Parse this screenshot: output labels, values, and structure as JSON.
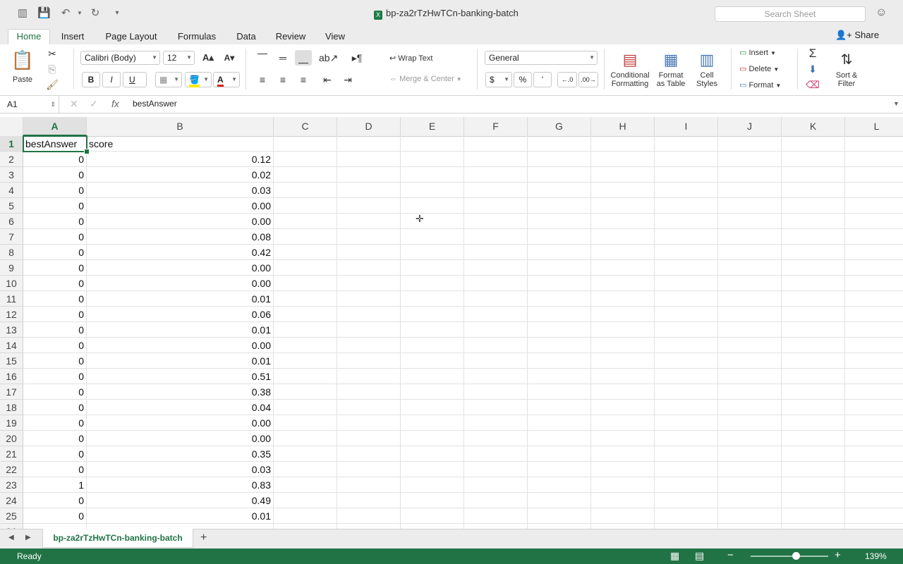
{
  "window": {
    "title": "bp-za2rTzHwTCn-banking-batch",
    "search_placeholder": "Search Sheet"
  },
  "tabs": [
    "Home",
    "Insert",
    "Page Layout",
    "Formulas",
    "Data",
    "Review",
    "View"
  ],
  "active_tab": "Home",
  "share_label": "Share",
  "ribbon": {
    "paste": "Paste",
    "font_name": "Calibri (Body)",
    "font_size": "12",
    "bold": "B",
    "italic": "I",
    "underline": "U",
    "wrap_text": "Wrap Text",
    "merge_center": "Merge & Center",
    "number_format": "General",
    "currency": "$",
    "percent": "%",
    "comma": "’",
    "conditional_formatting": [
      "Conditional",
      "Formatting"
    ],
    "format_as_table": [
      "Format",
      "as Table"
    ],
    "cell_styles": [
      "Cell",
      "Styles"
    ],
    "insert": "Insert",
    "delete": "Delete",
    "format": "Format",
    "sort_filter": [
      "Sort &",
      "Filter"
    ]
  },
  "formula_bar": {
    "name_box": "A1",
    "content": "bestAnswer"
  },
  "sheet": {
    "columns": [
      "A",
      "B",
      "C",
      "D",
      "E",
      "F",
      "G",
      "H",
      "I",
      "J",
      "K",
      "L"
    ],
    "rows": [
      [
        "bestAnswer",
        "score"
      ],
      [
        "0",
        "0.12"
      ],
      [
        "0",
        "0.02"
      ],
      [
        "0",
        "0.03"
      ],
      [
        "0",
        "0.00"
      ],
      [
        "0",
        "0.00"
      ],
      [
        "0",
        "0.08"
      ],
      [
        "0",
        "0.42"
      ],
      [
        "0",
        "0.00"
      ],
      [
        "0",
        "0.00"
      ],
      [
        "0",
        "0.01"
      ],
      [
        "0",
        "0.06"
      ],
      [
        "0",
        "0.01"
      ],
      [
        "0",
        "0.00"
      ],
      [
        "0",
        "0.01"
      ],
      [
        "0",
        "0.51"
      ],
      [
        "0",
        "0.38"
      ],
      [
        "0",
        "0.04"
      ],
      [
        "0",
        "0.00"
      ],
      [
        "0",
        "0.00"
      ],
      [
        "0",
        "0.35"
      ],
      [
        "0",
        "0.03"
      ],
      [
        "1",
        "0.83"
      ],
      [
        "0",
        "0.49"
      ],
      [
        "0",
        "0.01"
      ]
    ],
    "selected_cell": "A1"
  },
  "sheet_tab": "bp-za2rTzHwTCn-banking-batch",
  "status": {
    "text": "Ready",
    "zoom": "139%"
  },
  "colors": {
    "accent": "#217346"
  }
}
